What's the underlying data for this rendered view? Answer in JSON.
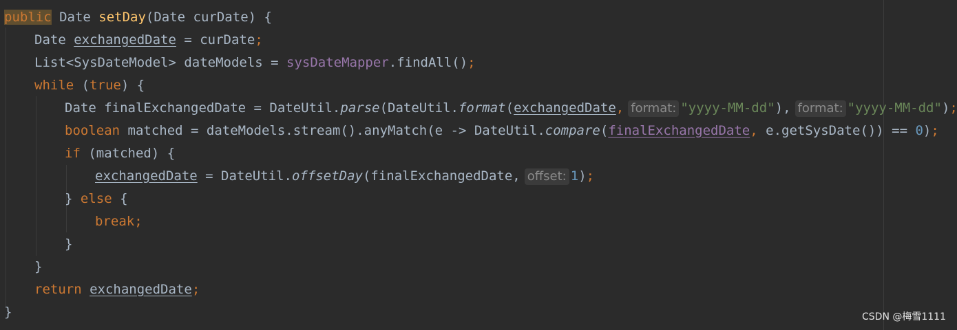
{
  "code": {
    "l1": {
      "public": "public",
      "sig": " Date ",
      "name": "setDay",
      "params": "(Date curDate) {"
    },
    "l2": {
      "a": "Date ",
      "var": "exchangedDate",
      "b": " = curDate",
      "semi": ";"
    },
    "l3": {
      "a": "List<SysDateModel> dateModels = ",
      "field": "sysDateMapper",
      "b": ".findAll()",
      "semi": ";"
    },
    "l4": {
      "kw": "while",
      "rest": " (",
      "kw2": "true",
      "rest2": ") {"
    },
    "l5": {
      "a": "Date finalExchangedDate = DateUtil.",
      "m1": "parse",
      "b": "(DateUtil.",
      "m2": "format",
      "c": "(",
      "var": "exchangedDate",
      "comma1": ",",
      "hint1": "format:",
      "str1": "\"yyyy-MM-dd\"",
      "d": "),",
      "hint2": "format:",
      "str2": "\"yyyy-MM-dd\"",
      "e": ")",
      "semi": ";"
    },
    "l6": {
      "kw": "boolean",
      "a": " matched = dateModels.stream().anyMatch(e -> DateUtil.",
      "m": "compare",
      "b": "(",
      "var": "finalExchangedDate",
      "comma": ",",
      "c": " e.getSysDate()) == ",
      "num": "0",
      "d": ")",
      "semi": ";"
    },
    "l7": {
      "kw": "if",
      "rest": " (matched) {"
    },
    "l8": {
      "var": "exchangedDate",
      "a": " = DateUtil.",
      "m": "offsetDay",
      "b": "(finalExchangedDate,",
      "hint": "offset:",
      "num": "1",
      "c": ")",
      "semi": ";"
    },
    "l9": {
      "a": "} ",
      "kw": "else",
      "b": " {"
    },
    "l10": {
      "kw": "break",
      "semi": ";"
    },
    "l11": {
      "a": "}"
    },
    "l12": {
      "a": "}"
    },
    "l13": {
      "kw": "return",
      "a": " ",
      "var": "exchangedDate",
      "semi": ";"
    },
    "l14": {
      "a": "}"
    }
  },
  "watermark": "CSDN @梅雪1111"
}
